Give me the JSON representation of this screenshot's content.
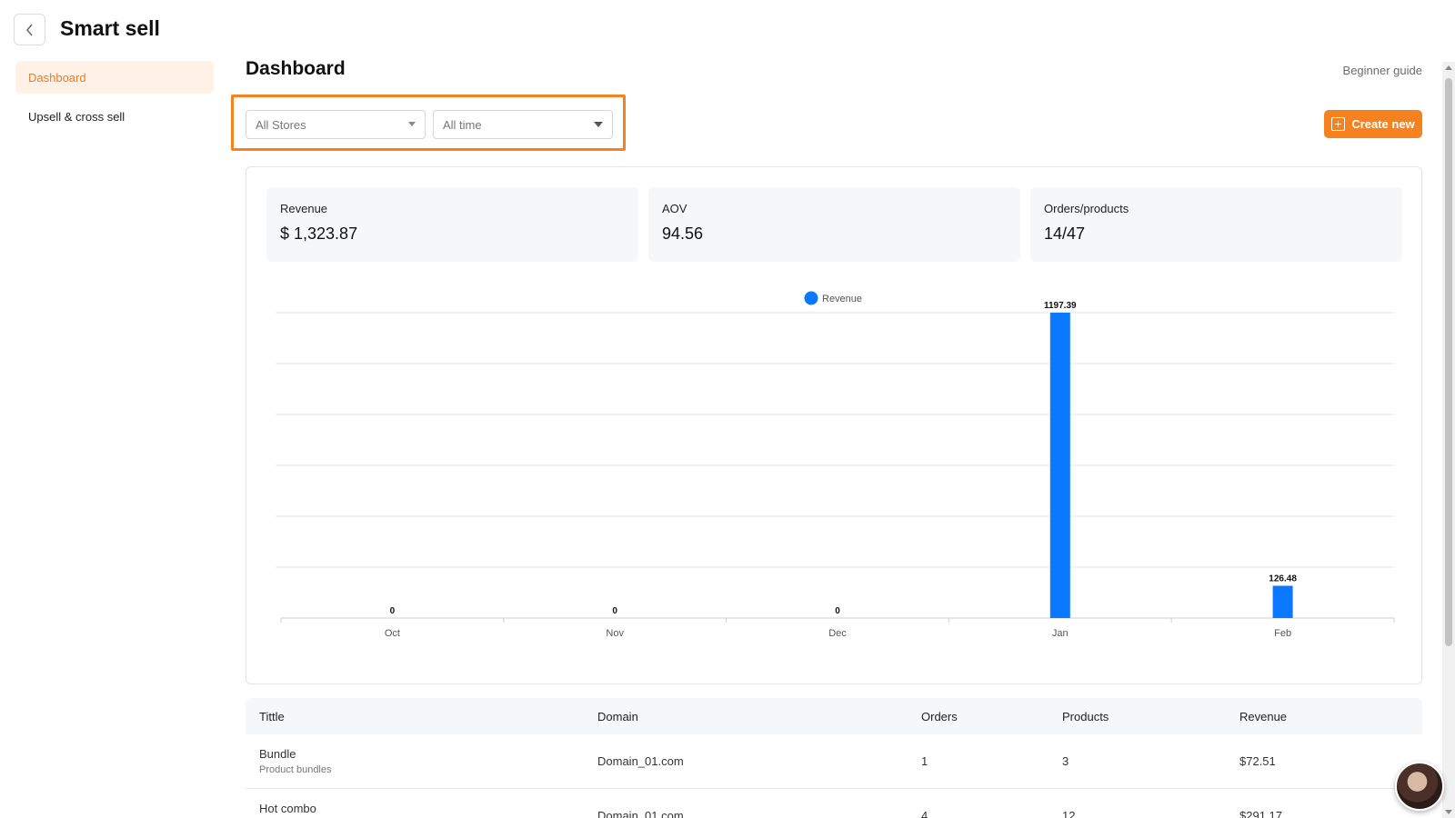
{
  "app": {
    "title": "Smart sell"
  },
  "sidebar": {
    "items": [
      {
        "label": "Dashboard",
        "active": true
      },
      {
        "label": "Upsell & cross sell",
        "active": false
      }
    ]
  },
  "header": {
    "title": "Dashboard",
    "guide_link": "Beginner guide"
  },
  "filters": {
    "store": "All Stores",
    "period": "All time"
  },
  "actions": {
    "create_label": "Create new"
  },
  "stats": [
    {
      "label": "Revenue",
      "value": "$ 1,323.87"
    },
    {
      "label": "AOV",
      "value": "94.56"
    },
    {
      "label": "Orders/products",
      "value": "14/47"
    }
  ],
  "colors": {
    "accent": "#f5821f",
    "bar": "#0a79ff",
    "active_bg": "#fff1e6"
  },
  "chart_data": {
    "type": "bar",
    "categories": [
      "Oct",
      "Nov",
      "Dec",
      "Jan",
      "Feb"
    ],
    "series": [
      {
        "name": "Revenue",
        "values": [
          0,
          0,
          0,
          1197.39,
          126.48
        ]
      }
    ],
    "data_labels": [
      "0",
      "0",
      "0",
      "1197.39",
      "126.48"
    ],
    "ylim": [
      0,
      1197.39
    ],
    "grid": true,
    "legend": "top-center"
  },
  "table": {
    "columns": [
      "Tittle",
      "Domain",
      "Orders",
      "Products",
      "Revenue"
    ],
    "rows": [
      {
        "title": "Bundle",
        "subtitle": "Product bundles",
        "domain": "Domain_01.com",
        "orders": "1",
        "products": "3",
        "revenue": "$72.51"
      },
      {
        "title": "Hot combo",
        "subtitle": "",
        "domain": "Domain_01.com",
        "orders": "4",
        "products": "12",
        "revenue": "$291.17"
      }
    ]
  }
}
